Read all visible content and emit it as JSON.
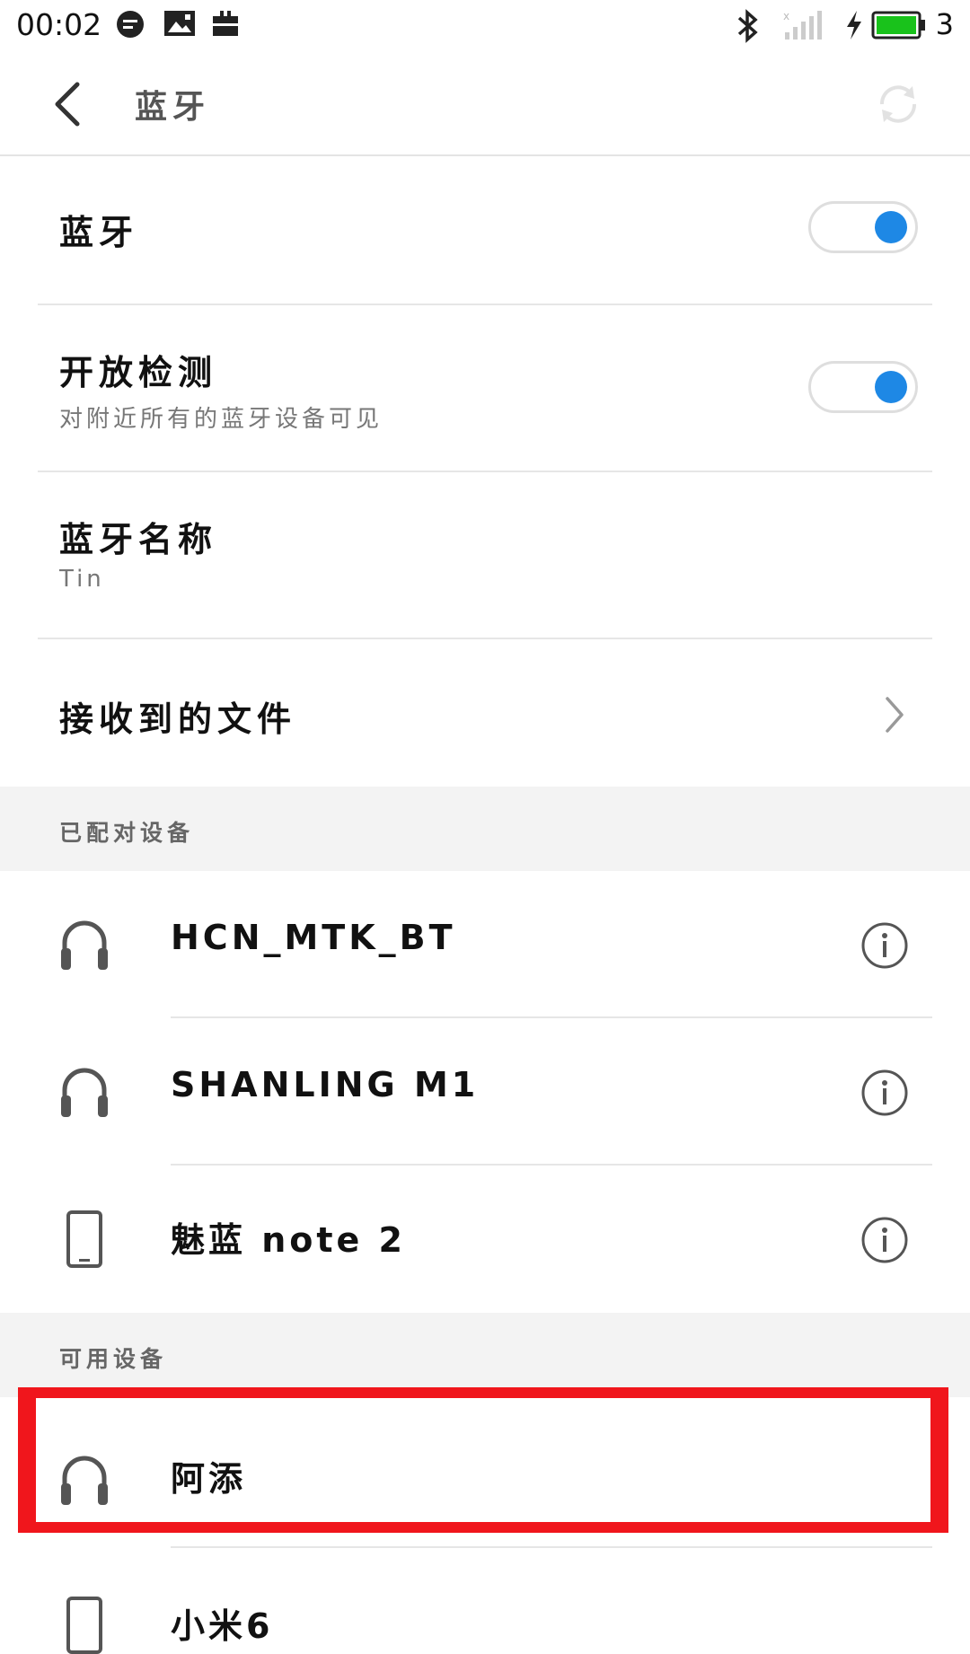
{
  "status_bar": {
    "time": "00:02",
    "battery_percent": "3",
    "icons": [
      "message-icon",
      "image-icon",
      "briefcase-icon",
      "bluetooth-icon",
      "signal-icon",
      "charging-icon",
      "battery-icon"
    ]
  },
  "nav": {
    "title": "蓝牙",
    "back_icon": "back-arrow-icon",
    "refresh_icon": "refresh-icon"
  },
  "settings": {
    "bluetooth": {
      "label": "蓝牙",
      "enabled": true
    },
    "discoverable": {
      "label": "开放检测",
      "subtitle": "对附近所有的蓝牙设备可见",
      "enabled": true
    },
    "device_name": {
      "label": "蓝牙名称",
      "value": "Tin"
    },
    "received_files": {
      "label": "接收到的文件"
    }
  },
  "paired_section": {
    "label": "已配对设备",
    "devices": [
      {
        "name": "HCN_MTK_BT",
        "icon": "headphones-icon"
      },
      {
        "name": "SHANLING M1",
        "icon": "headphones-icon"
      },
      {
        "name": "魅蓝 note 2",
        "icon": "phone-icon"
      }
    ]
  },
  "available_section": {
    "label": "可用设备",
    "devices": [
      {
        "name": "阿添",
        "icon": "headphones-icon",
        "highlighted": true
      },
      {
        "name": "小米6",
        "icon": "phone-icon"
      }
    ]
  },
  "colors": {
    "accent": "#1e88e5",
    "highlight": "#f0161c",
    "section_bg": "#f3f3f3"
  }
}
